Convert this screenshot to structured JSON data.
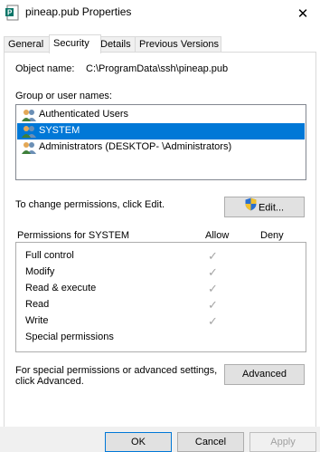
{
  "window": {
    "title": "pineap.pub Properties",
    "close_glyph": "✕"
  },
  "tabs": [
    {
      "label": "General",
      "active": false
    },
    {
      "label": "Security",
      "active": true
    },
    {
      "label": "Details",
      "active": false
    },
    {
      "label": "Previous Versions",
      "active": false
    }
  ],
  "object": {
    "label": "Object name:",
    "value": "C:\\ProgramData\\ssh\\pineap.pub"
  },
  "groups": {
    "label": "Group or user names:",
    "items": [
      {
        "name": "Authenticated Users",
        "icon": "users-icon",
        "selected": false
      },
      {
        "name": "SYSTEM",
        "icon": "users-icon",
        "selected": true
      },
      {
        "name": "Administrators (DESKTOP-                \\Administrators)",
        "icon": "users-icon",
        "selected": false
      }
    ]
  },
  "change_text": "To change permissions, click Edit.",
  "edit_button": {
    "label": "Edit...",
    "icon": "shield-icon"
  },
  "permissions": {
    "label": "Permissions for SYSTEM",
    "allow_label": "Allow",
    "deny_label": "Deny",
    "check_glyph": "✓",
    "items": [
      {
        "name": "Full control",
        "allow": true,
        "deny": false
      },
      {
        "name": "Modify",
        "allow": true,
        "deny": false
      },
      {
        "name": "Read & execute",
        "allow": true,
        "deny": false
      },
      {
        "name": "Read",
        "allow": true,
        "deny": false
      },
      {
        "name": "Write",
        "allow": true,
        "deny": false
      },
      {
        "name": "Special permissions",
        "allow": false,
        "deny": false
      }
    ]
  },
  "advanced": {
    "text_line1": "For special permissions or advanced settings,",
    "text_line2": "click Advanced.",
    "button": "Advanced"
  },
  "footer": {
    "ok": "OK",
    "cancel": "Cancel",
    "apply": "Apply"
  },
  "colors": {
    "selection": "#0078d7",
    "check": "#a5a5a5"
  }
}
